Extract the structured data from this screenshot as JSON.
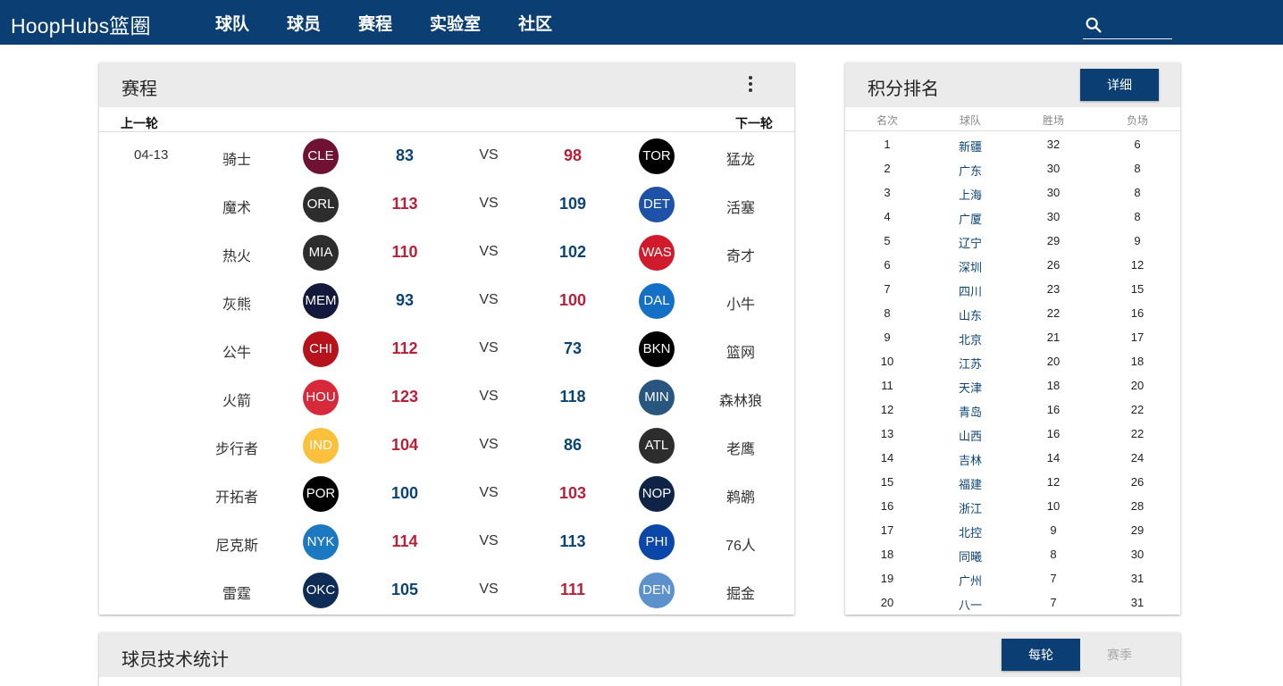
{
  "brand": "HoopHubs篮圈",
  "nav": [
    "球队",
    "球员",
    "赛程",
    "实验室",
    "社区"
  ],
  "search": {
    "placeholder": ""
  },
  "schedule": {
    "title": "赛程",
    "prev": "上一轮",
    "next": "下一轮",
    "date": "04-13",
    "vs": "VS",
    "games": [
      {
        "home": "骑士",
        "home_abbr": "CLE",
        "home_color": "#6f1133",
        "home_score": "83",
        "away_score": "98",
        "away_abbr": "TOR",
        "away_color": "#000000",
        "away": "猛龙"
      },
      {
        "home": "魔术",
        "home_abbr": "ORL",
        "home_color": "#2d2d2d",
        "home_score": "113",
        "away_score": "109",
        "away_abbr": "DET",
        "away_color": "#1d52a6",
        "away": "活塞"
      },
      {
        "home": "热火",
        "home_abbr": "MIA",
        "home_color": "#2d2d2d",
        "home_score": "110",
        "away_score": "102",
        "away_abbr": "WAS",
        "away_color": "#cf1b2b",
        "away": "奇才"
      },
      {
        "home": "灰熊",
        "home_abbr": "MEM",
        "home_color": "#13183d",
        "home_score": "93",
        "away_score": "100",
        "away_abbr": "DAL",
        "away_color": "#1470c4",
        "away": "小牛"
      },
      {
        "home": "公牛",
        "home_abbr": "CHI",
        "home_color": "#b5121b",
        "home_score": "112",
        "away_score": "73",
        "away_abbr": "BKN",
        "away_color": "#000000",
        "away": "篮网"
      },
      {
        "home": "火箭",
        "home_abbr": "HOU",
        "home_color": "#d6293b",
        "home_score": "123",
        "away_score": "118",
        "away_abbr": "MIN",
        "away_color": "#28567f",
        "away": "森林狼"
      },
      {
        "home": "步行者",
        "home_abbr": "IND",
        "home_color": "#fbc13c",
        "home_score": "104",
        "away_score": "86",
        "away_abbr": "ATL",
        "away_color": "#2d2d2d",
        "away": "老鹰"
      },
      {
        "home": "开拓者",
        "home_abbr": "POR",
        "home_color": "#000000",
        "home_score": "100",
        "away_score": "103",
        "away_abbr": "NOP",
        "away_color": "#0e2345",
        "away": "鹈鹕"
      },
      {
        "home": "尼克斯",
        "home_abbr": "NYK",
        "home_color": "#1d78c2",
        "home_score": "114",
        "away_score": "113",
        "away_abbr": "PHI",
        "away_color": "#0b47a8",
        "away": "76人"
      },
      {
        "home": "雷霆",
        "home_abbr": "OKC",
        "home_color": "#0e2c55",
        "home_score": "105",
        "away_score": "111",
        "away_abbr": "DEN",
        "away_color": "#5b92cb",
        "away": "掘金"
      }
    ]
  },
  "standings": {
    "title": "积分排名",
    "detail_label": "详细",
    "headers": [
      "名次",
      "球队",
      "胜场",
      "负场"
    ],
    "rows": [
      [
        "1",
        "新疆",
        "32",
        "6"
      ],
      [
        "2",
        "广东",
        "30",
        "8"
      ],
      [
        "3",
        "上海",
        "30",
        "8"
      ],
      [
        "4",
        "广厦",
        "30",
        "8"
      ],
      [
        "5",
        "辽宁",
        "29",
        "9"
      ],
      [
        "6",
        "深圳",
        "26",
        "12"
      ],
      [
        "7",
        "四川",
        "23",
        "15"
      ],
      [
        "8",
        "山东",
        "22",
        "16"
      ],
      [
        "9",
        "北京",
        "21",
        "17"
      ],
      [
        "10",
        "江苏",
        "20",
        "18"
      ],
      [
        "11",
        "天津",
        "18",
        "20"
      ],
      [
        "12",
        "青岛",
        "16",
        "22"
      ],
      [
        "13",
        "山西",
        "16",
        "22"
      ],
      [
        "14",
        "吉林",
        "14",
        "24"
      ],
      [
        "15",
        "福建",
        "12",
        "26"
      ],
      [
        "16",
        "浙江",
        "10",
        "28"
      ],
      [
        "17",
        "北控",
        "9",
        "29"
      ],
      [
        "18",
        "同曦",
        "8",
        "30"
      ],
      [
        "19",
        "广州",
        "7",
        "31"
      ],
      [
        "20",
        "八一",
        "7",
        "31"
      ]
    ]
  },
  "player_stats": {
    "title": "球员技术统计",
    "tab_active": "每轮",
    "tab_inactive": "赛季"
  }
}
